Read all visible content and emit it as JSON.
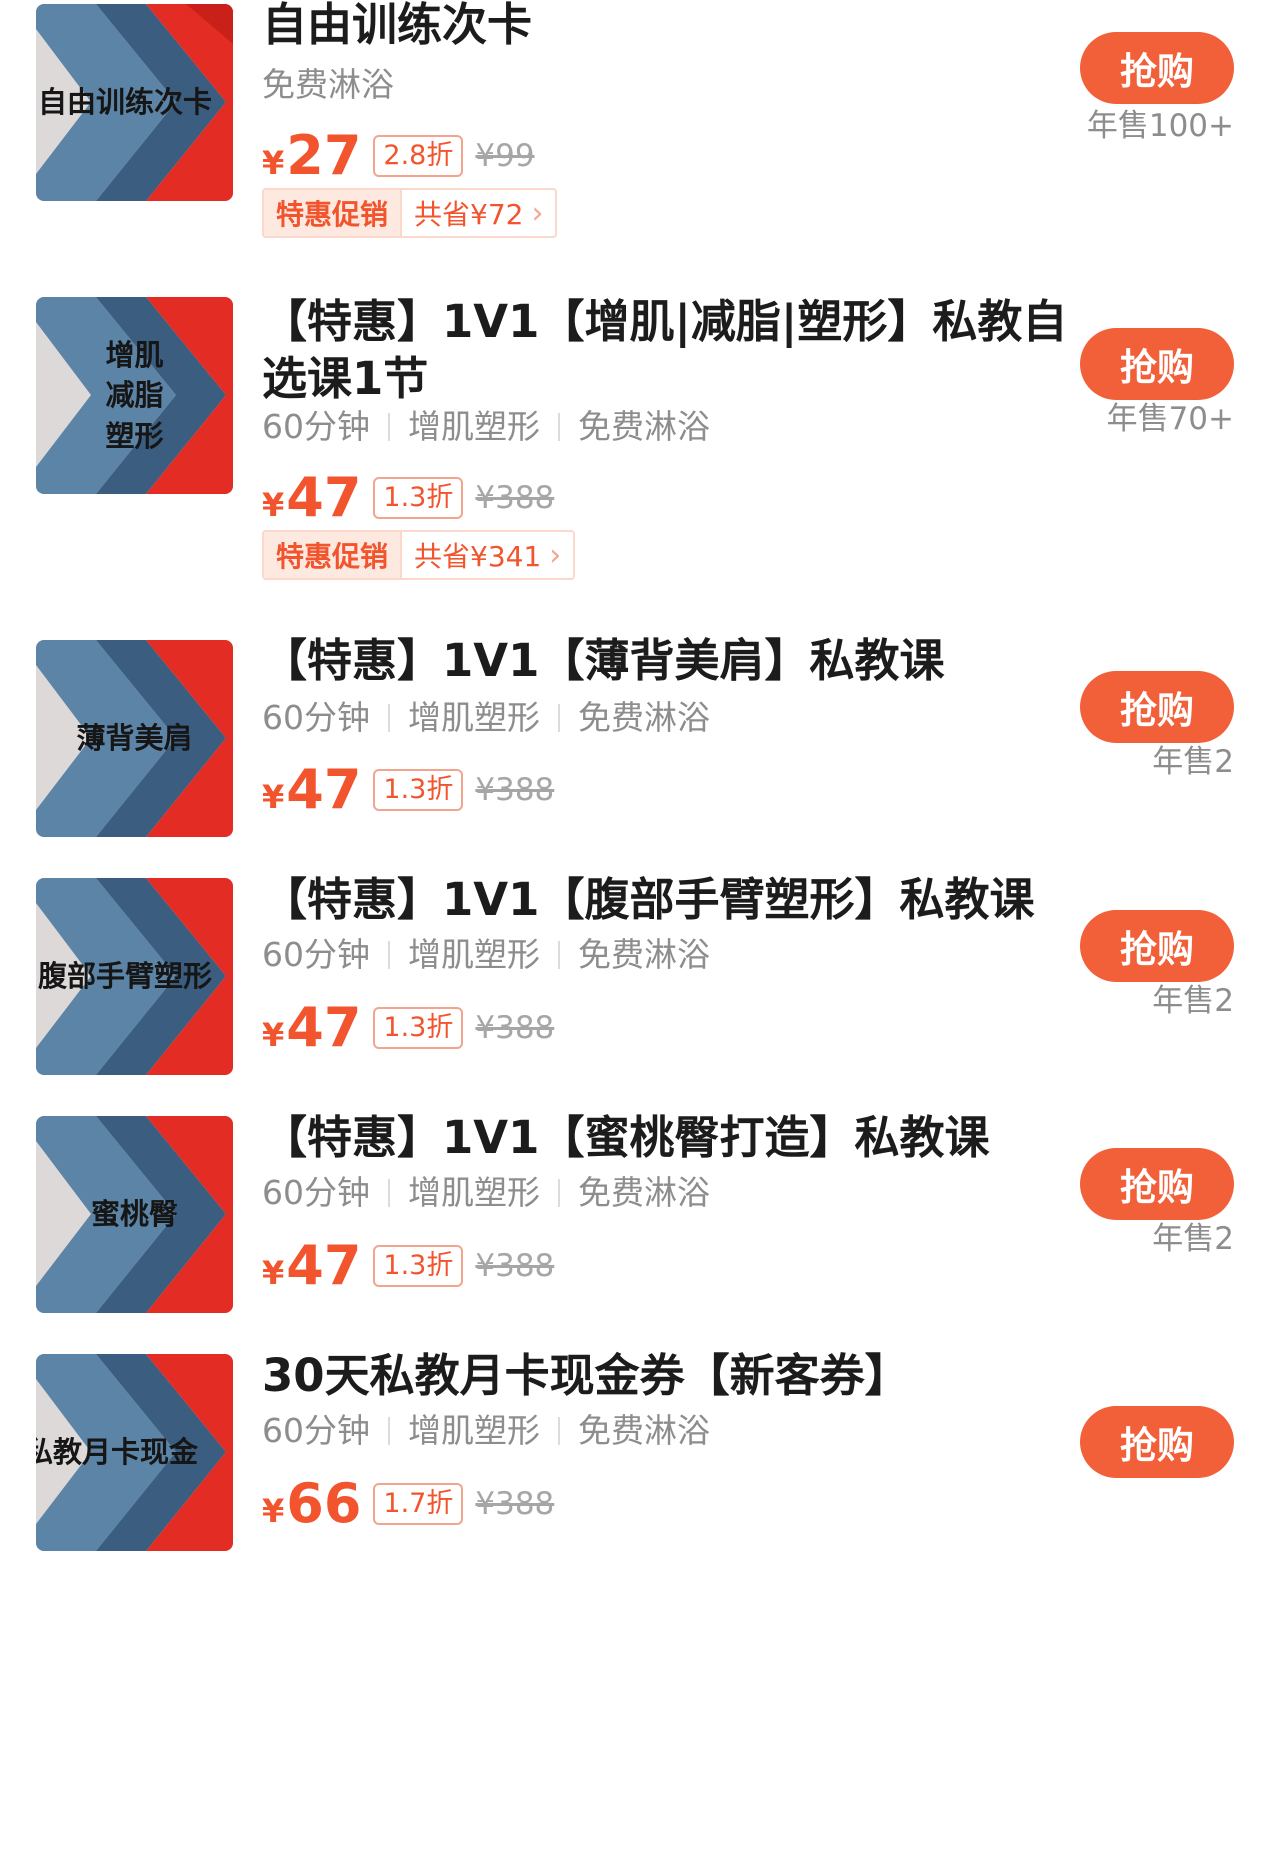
{
  "currency": "¥",
  "colors": {
    "accent": "#f2542d",
    "button": "#f2603a",
    "promo_bg": "#fde9e0"
  },
  "products": [
    {
      "thumb_lines": [
        "自由训练次卡"
      ],
      "title": "自由训练次卡",
      "tags": [
        "免费淋浴"
      ],
      "price": "27",
      "discount": "2.8折",
      "original": "¥99",
      "promo": {
        "label": "特惠促销",
        "save": "共省¥72"
      },
      "buy_label": "抢购",
      "sold": "年售100+"
    },
    {
      "thumb_lines": [
        "增肌",
        "减脂",
        "塑形"
      ],
      "title": "【特惠】1V1【增肌|减脂|塑形】私教自选课1节",
      "tags": [
        "60分钟",
        "增肌塑形",
        "免费淋浴"
      ],
      "price": "47",
      "discount": "1.3折",
      "original": "¥388",
      "promo": {
        "label": "特惠促销",
        "save": "共省¥341"
      },
      "buy_label": "抢购",
      "sold": "年售70+"
    },
    {
      "thumb_lines": [
        "薄背美肩"
      ],
      "title": "【特惠】1V1【薄背美肩】私教课",
      "tags": [
        "60分钟",
        "增肌塑形",
        "免费淋浴"
      ],
      "price": "47",
      "discount": "1.3折",
      "original": "¥388",
      "buy_label": "抢购",
      "sold": "年售2"
    },
    {
      "thumb_lines": [
        "腹部手臂塑形"
      ],
      "title": "【特惠】1V1【腹部手臂塑形】私教课",
      "tags": [
        "60分钟",
        "增肌塑形",
        "免费淋浴"
      ],
      "price": "47",
      "discount": "1.3折",
      "original": "¥388",
      "buy_label": "抢购",
      "sold": "年售2"
    },
    {
      "thumb_lines": [
        "蜜桃臀"
      ],
      "title": "【特惠】1V1【蜜桃臀打造】私教课",
      "tags": [
        "60分钟",
        "增肌塑形",
        "免费淋浴"
      ],
      "price": "47",
      "discount": "1.3折",
      "original": "¥388",
      "buy_label": "抢购",
      "sold": "年售2"
    },
    {
      "thumb_lines": [
        "私教月卡现金"
      ],
      "title": "30天私教月卡现金券【新客券】",
      "tags": [
        "60分钟",
        "增肌塑形",
        "免费淋浴"
      ],
      "price": "66",
      "discount": "1.7折",
      "original": "¥388",
      "buy_label": "抢购"
    }
  ]
}
